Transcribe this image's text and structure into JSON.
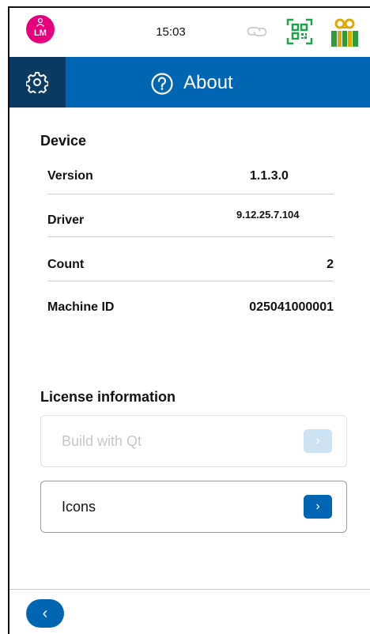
{
  "status_bar": {
    "avatar_initials": "LM",
    "time": "15:03",
    "icons": [
      "link-icon",
      "qr-code-icon",
      "voucher-gift-icon"
    ]
  },
  "header": {
    "settings_icon": "gear-icon",
    "help_icon": "question-circle-icon",
    "title": "About"
  },
  "device": {
    "section_title": "Device",
    "rows": [
      {
        "label": "Version",
        "value": "1.1.3.0"
      },
      {
        "label": "Driver",
        "value": "9.12.25.7.104"
      },
      {
        "label": "Count",
        "value": "2"
      },
      {
        "label": "Machine ID",
        "value": "025041000001"
      }
    ]
  },
  "license": {
    "section_title": "License information",
    "items": [
      {
        "label": "Build with Qt",
        "enabled": false
      },
      {
        "label": "Icons",
        "enabled": true
      }
    ],
    "arrow_glyph": "›"
  },
  "footer": {
    "back_glyph": "‹"
  },
  "colors": {
    "primary_blue": "#0066b3",
    "dark_navy": "#0b3a63",
    "avatar_magenta": "#e6007e",
    "qr_green": "#1aa34a",
    "gift_gold": "#e0a800",
    "gift_green": "#2e9b3a"
  }
}
